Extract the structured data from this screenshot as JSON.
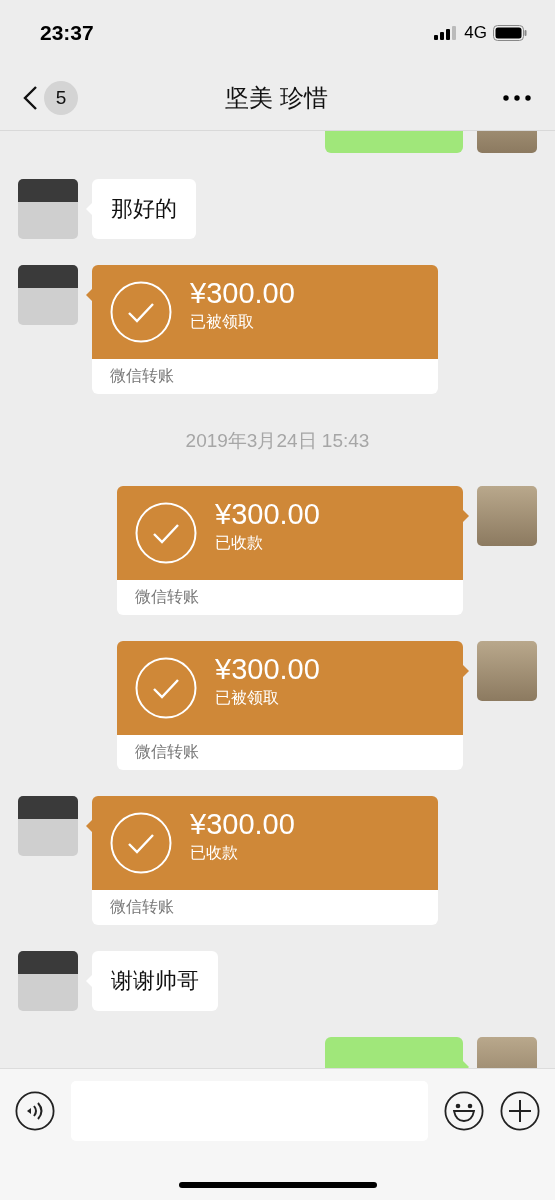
{
  "status_bar": {
    "time": "23:37",
    "network": "4G"
  },
  "nav": {
    "unread_count": "5",
    "title": "坚美 珍惜"
  },
  "messages": [
    {
      "kind": "partial",
      "outgoing": true
    },
    {
      "kind": "text",
      "outgoing": false,
      "text": "那好的"
    },
    {
      "kind": "transfer",
      "outgoing": false,
      "amount": "¥300.00",
      "status": "已被领取",
      "label": "微信转账"
    },
    {
      "kind": "time",
      "text": "2019年3月24日 15:43"
    },
    {
      "kind": "transfer",
      "outgoing": true,
      "amount": "¥300.00",
      "status": "已收款",
      "label": "微信转账"
    },
    {
      "kind": "transfer",
      "outgoing": true,
      "amount": "¥300.00",
      "status": "已被领取",
      "label": "微信转账"
    },
    {
      "kind": "transfer",
      "outgoing": false,
      "amount": "¥300.00",
      "status": "已收款",
      "label": "微信转账"
    },
    {
      "kind": "text",
      "outgoing": false,
      "text": "谢谢帅哥"
    },
    {
      "kind": "partial",
      "outgoing": true
    }
  ]
}
